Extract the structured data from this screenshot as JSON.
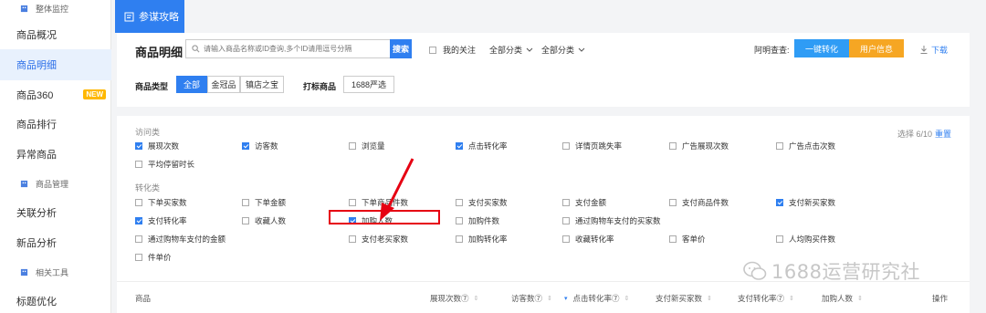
{
  "sidebar": {
    "items": [
      {
        "label": "整体监控",
        "sub": true
      },
      {
        "label": "商品概况"
      },
      {
        "label": "商品明细",
        "active": true
      },
      {
        "label": "商品360",
        "badge": "NEW"
      },
      {
        "label": "商品排行"
      },
      {
        "label": "异常商品"
      },
      {
        "label": "商品管理",
        "sub": true
      },
      {
        "label": "关联分析"
      },
      {
        "label": "新品分析"
      },
      {
        "label": "相关工具",
        "sub": true
      },
      {
        "label": "标题优化"
      }
    ]
  },
  "tab": {
    "label": "参谋攻略"
  },
  "header": {
    "title": "商品明细",
    "search_placeholder": "请输入商品名称或ID查询,多个ID请用逗号分隔",
    "search_button": "搜索",
    "my_follow": "我的关注",
    "category1": "全部分类",
    "category2": "全部分类",
    "ami_label": "阿明查查:",
    "convert_button": "一键转化",
    "user_info_button": "用户信息",
    "download": "下载"
  },
  "filters": {
    "category_label": "商品类型",
    "categories": [
      "全部",
      "金冠品",
      "镇店之宝"
    ],
    "tag_label": "打标商品",
    "tag_value": "1688严选"
  },
  "metrics": {
    "selection": "选择 6/10",
    "reset": "重置",
    "visit_label": "访问类",
    "visit_options": [
      {
        "label": "展现次数",
        "checked": true
      },
      {
        "label": "访客数",
        "checked": true
      },
      {
        "label": "浏览量",
        "checked": false
      },
      {
        "label": "点击转化率",
        "checked": true
      },
      {
        "label": "详情页跳失率",
        "checked": false
      },
      {
        "label": "广告展现次数",
        "checked": false
      },
      {
        "label": "广告点击次数",
        "checked": false
      },
      {
        "label": "平均停留时长",
        "checked": false
      }
    ],
    "convert_label": "转化类",
    "convert_options": [
      {
        "label": "下单买家数",
        "checked": false
      },
      {
        "label": "下单金额",
        "checked": false
      },
      {
        "label": "下单商品件数",
        "checked": false
      },
      {
        "label": "支付买家数",
        "checked": false
      },
      {
        "label": "支付金额",
        "checked": false
      },
      {
        "label": "支付商品件数",
        "checked": false
      },
      {
        "label": "支付新买家数",
        "checked": true
      },
      {
        "label": "支付转化率",
        "checked": true
      },
      {
        "label": "收藏人数",
        "checked": false
      },
      {
        "label": "加购人数",
        "checked": true
      },
      {
        "label": "加购件数",
        "checked": false
      },
      {
        "label": "通过购物车支付的买家数",
        "checked": false
      },
      {
        "label": "通过购物车支付的金额",
        "checked": false
      },
      {
        "label": "支付老买家数",
        "checked": false
      },
      {
        "label": "加购转化率",
        "checked": false
      },
      {
        "label": "收藏转化率",
        "checked": false
      },
      {
        "label": "客单价",
        "checked": false
      },
      {
        "label": "人均购买件数",
        "checked": false
      },
      {
        "label": "件单价",
        "checked": false
      }
    ]
  },
  "table": {
    "columns": [
      "商品",
      "展现次数⑦",
      "访客数⑦",
      "点击转化率⑦",
      "支付新买家数",
      "支付转化率⑦",
      "加购人数",
      "操作"
    ]
  },
  "watermark": "1688运营研究社",
  "colors": {
    "accent": "#2f7ff0",
    "orange": "#f6a623",
    "highlight": "#e60012"
  }
}
